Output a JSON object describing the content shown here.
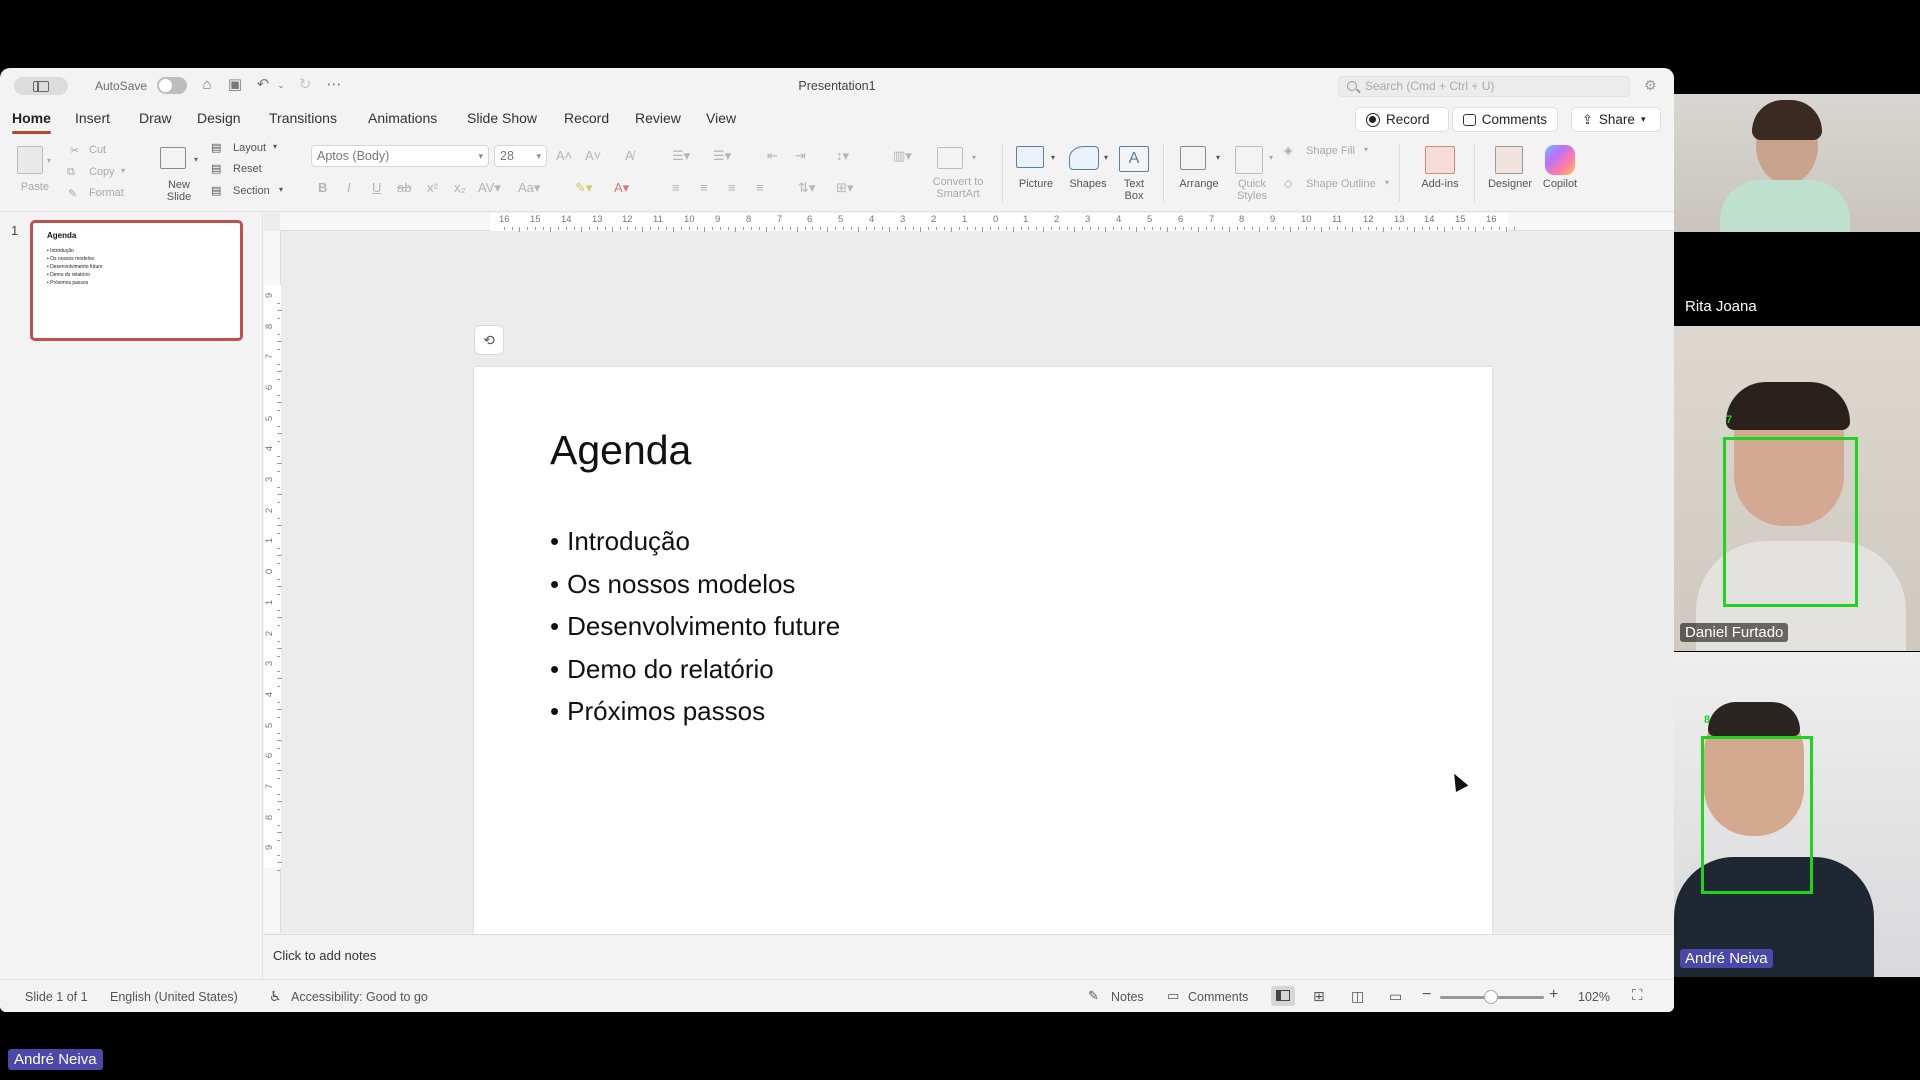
{
  "window": {
    "title": "Presentation1",
    "autosave_label": "AutoSave",
    "search_placeholder": "Search (Cmd + Ctrl + U)"
  },
  "tabs": [
    "Home",
    "Insert",
    "Draw",
    "Design",
    "Transitions",
    "Animations",
    "Slide Show",
    "Record",
    "Review",
    "View"
  ],
  "actions": {
    "record": "Record",
    "comments": "Comments",
    "share": "Share"
  },
  "ribbon": {
    "paste": "Paste",
    "cut": "Cut",
    "copy": "Copy",
    "format": "Format",
    "new_slide": "New Slide",
    "layout": "Layout",
    "reset": "Reset",
    "section": "Section",
    "font_name": "Aptos (Body)",
    "font_size": "28",
    "convert_smartart": "Convert to SmartArt",
    "picture": "Picture",
    "shapes": "Shapes",
    "text_box": "Text Box",
    "arrange": "Arrange",
    "quick_styles": "Quick Styles",
    "shape_fill": "Shape Fill",
    "shape_outline": "Shape Outline",
    "add_ins": "Add-ins",
    "designer": "Designer",
    "copilot": "Copilot"
  },
  "thumbnail": {
    "number": "1",
    "title": "Agenda",
    "items": [
      "• Introdução",
      "• Os nossos modelos",
      "• Desenvolvimento future",
      "• Demo do relatório",
      "• Próximos passos"
    ]
  },
  "ruler": {
    "h_numbers": [
      "16",
      "15",
      "14",
      "13",
      "12",
      "11",
      "10",
      "9",
      "8",
      "7",
      "6",
      "5",
      "4",
      "3",
      "2",
      "1",
      "0",
      "1",
      "2",
      "3",
      "4",
      "5",
      "6",
      "7",
      "8",
      "9",
      "10",
      "11",
      "12",
      "13",
      "14",
      "15",
      "16"
    ],
    "v_numbers": [
      "9",
      "8",
      "7",
      "6",
      "5",
      "4",
      "3",
      "2",
      "1",
      "0",
      "1",
      "2",
      "3",
      "4",
      "5",
      "6",
      "7",
      "8",
      "9"
    ]
  },
  "slide": {
    "title": "Agenda",
    "bullets": [
      "Introdução",
      "Os nossos modelos",
      "Desenvolvimento future",
      "Demo do relatório",
      "Próximos passos"
    ]
  },
  "notes_placeholder": "Click to add notes",
  "statusbar": {
    "slide_info": "Slide 1 of 1",
    "language": "English (United States)",
    "accessibility": "Accessibility: Good to go",
    "notes": "Notes",
    "comments": "Comments",
    "zoom": "102%"
  },
  "participants": [
    {
      "name": "Rita Joana"
    },
    {
      "name": "Daniel Furtado",
      "face_label": "7"
    },
    {
      "name": "André Neiva",
      "face_label": "8"
    }
  ],
  "presenter_tag": "André Neiva",
  "colors": {
    "accent": "#b7472a",
    "thumb_border": "#c0504d",
    "face_box": "#1dd51d",
    "name_tag_active": "#4b48a9"
  }
}
